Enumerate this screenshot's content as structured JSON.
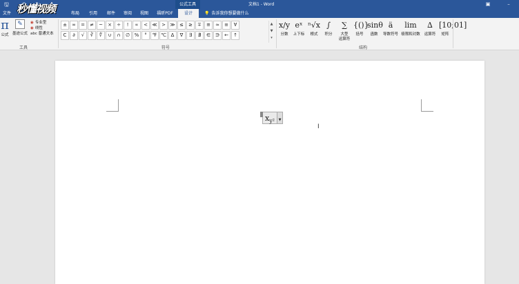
{
  "titlebar": {
    "save_icon": "save-icon",
    "undo_icon": "undo-icon",
    "redo_icon": "redo-icon",
    "format_icon": "format-painter-icon",
    "contextual_tab": "公式工具",
    "doc_title": "文档1 - Word",
    "logo_text": "秒懂视频",
    "accent": "#2b579a"
  },
  "tabs": [
    {
      "label": "文件"
    },
    {
      "label": "布局"
    },
    {
      "label": "引用"
    },
    {
      "label": "邮件"
    },
    {
      "label": "审阅"
    },
    {
      "label": "视图"
    },
    {
      "label": "福昕PDF"
    },
    {
      "label": "设计"
    }
  ],
  "tellme": "告诉我你想要做什么",
  "tools": {
    "equation_label": "公式",
    "ink_label": "墨迹公式",
    "professional": "专业型",
    "linear": "线性",
    "normal_text": "abc 普通文本",
    "group_label": "工具"
  },
  "symbols": {
    "row1": [
      "±",
      "∞",
      "=",
      "≠",
      "~",
      "×",
      "÷",
      "!",
      "∝",
      "<",
      "≪",
      ">",
      "≫",
      "≤",
      "≥",
      "∓",
      "≅",
      "≈",
      "≡",
      "∀"
    ],
    "row2": [
      "C",
      "∂",
      "√",
      "∛",
      "∜",
      "∪",
      "∩",
      "∅",
      "%",
      "°",
      "℉",
      "℃",
      "∆",
      "∇",
      "∃",
      "∄",
      "∈",
      "∋",
      "←",
      "↑"
    ],
    "group_label": "符号"
  },
  "structures": [
    {
      "glyph": "x/y",
      "label": "分数"
    },
    {
      "glyph": "eˣ",
      "label": "上下标"
    },
    {
      "glyph": "ⁿ√x",
      "label": "根式"
    },
    {
      "glyph": "∫",
      "label": "积分"
    },
    {
      "glyph": "∑",
      "label": "大型",
      "label2": "运算符"
    },
    {
      "glyph": "{()}",
      "label": "括号"
    },
    {
      "glyph": "sinθ",
      "label": "函数"
    },
    {
      "glyph": "ä",
      "label": "导数符号"
    },
    {
      "glyph": "lim",
      "label": "极限和对数"
    },
    {
      "glyph": "∆",
      "label": "运算符"
    },
    {
      "glyph": "[10;01]",
      "label": "矩阵"
    }
  ],
  "structures_group_label": "结构",
  "equation": {
    "base": "x",
    "sub": "y²"
  }
}
